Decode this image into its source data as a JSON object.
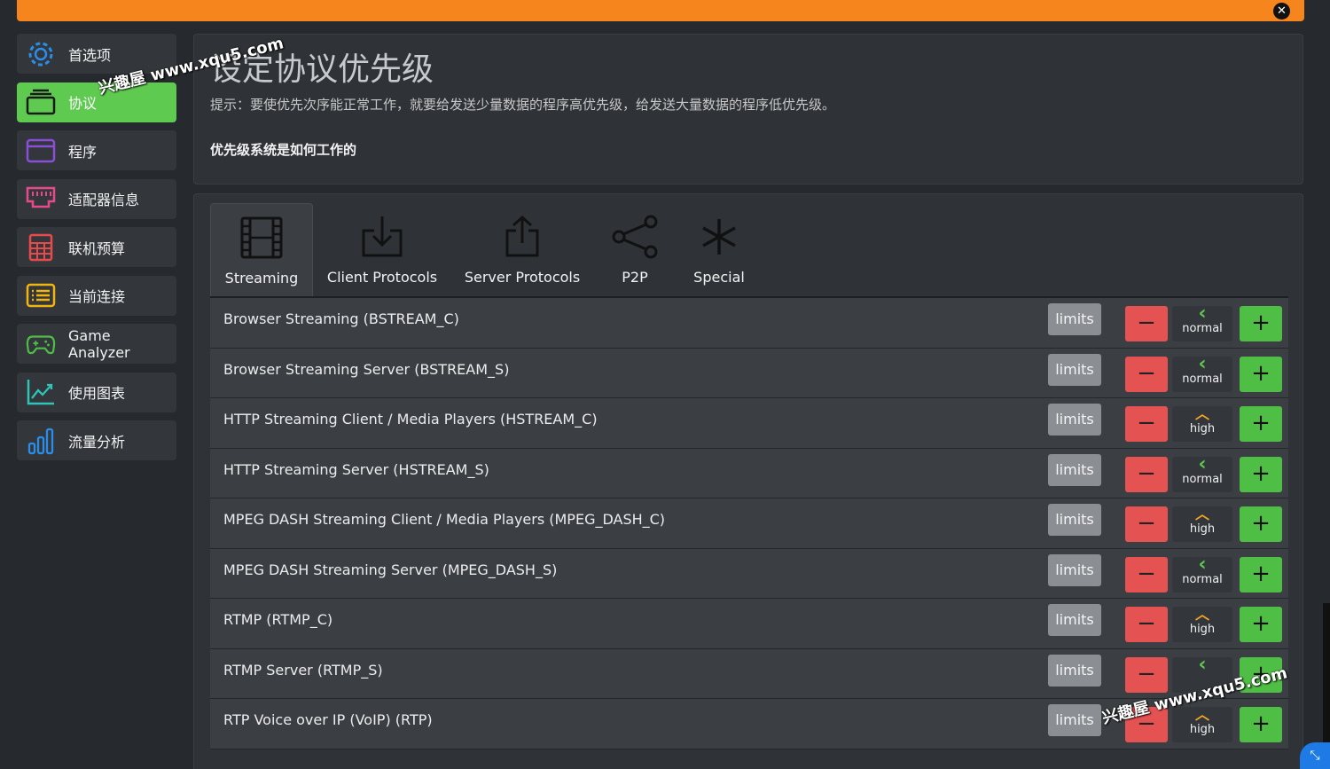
{
  "sidebar": {
    "items": [
      {
        "label": "首选项",
        "icon": "gear-icon",
        "active": false
      },
      {
        "label": "协议",
        "icon": "stack-icon",
        "active": true
      },
      {
        "label": "程序",
        "icon": "window-icon",
        "active": false
      },
      {
        "label": "适配器信息",
        "icon": "network-adapter-icon",
        "active": false
      },
      {
        "label": "联机预算",
        "icon": "calculator-icon",
        "active": false
      },
      {
        "label": "当前连接",
        "icon": "list-icon",
        "active": false
      },
      {
        "label": "Game Analyzer",
        "icon": "gamepad-icon",
        "active": false
      },
      {
        "label": "使用图表",
        "icon": "line-chart-icon",
        "active": false
      },
      {
        "label": "流量分析",
        "icon": "bar-chart-icon",
        "active": false
      }
    ]
  },
  "header": {
    "title": "设定协议优先级",
    "hint": "提示：要使优先次序能正常工作，就要给发送少量数据的程序高优先级，给发送大量数据的程序低优先级。",
    "how_link": "优先级系统是如何工作的"
  },
  "tabs": [
    {
      "label": "Streaming",
      "icon": "film-icon",
      "active": true
    },
    {
      "label": "Client Protocols",
      "icon": "download-icon",
      "active": false
    },
    {
      "label": "Server Protocols",
      "icon": "share-upload-icon",
      "active": false
    },
    {
      "label": "P2P",
      "icon": "share-nodes-icon",
      "active": false
    },
    {
      "label": "Special",
      "icon": "asterisk-icon",
      "active": false
    }
  ],
  "protocols": [
    {
      "name": "Browser Streaming (BSTREAM_C)",
      "limits": "limits",
      "priority": "normal"
    },
    {
      "name": "Browser Streaming Server (BSTREAM_S)",
      "limits": "limits",
      "priority": "normal"
    },
    {
      "name": "HTTP Streaming Client / Media Players (HSTREAM_C)",
      "limits": "limits",
      "priority": "high"
    },
    {
      "name": "HTTP Streaming Server (HSTREAM_S)",
      "limits": "limits",
      "priority": "normal"
    },
    {
      "name": "MPEG DASH Streaming Client / Media Players (MPEG_DASH_C)",
      "limits": "limits",
      "priority": "high"
    },
    {
      "name": "MPEG DASH Streaming Server (MPEG_DASH_S)",
      "limits": "limits",
      "priority": "normal"
    },
    {
      "name": "RTMP (RTMP_C)",
      "limits": "limits",
      "priority": "high"
    },
    {
      "name": "RTMP Server (RTMP_S)",
      "limits": "limits",
      "priority": ""
    },
    {
      "name": "RTP Voice over IP (VoIP) (RTP)",
      "limits": "limits",
      "priority": "high"
    }
  ],
  "buttons": {
    "minus": "−",
    "plus": "+"
  },
  "colors": {
    "accent_orange": "#f7851d",
    "active_green": "#5fca50",
    "minus_red": "#e55252",
    "plus_green": "#4fbe45",
    "high_arrow": "#f5a623",
    "normal_arrow": "#5fca50"
  },
  "watermark": {
    "text_top": "兴趣屋 www.xqu5.com",
    "text_bottom": "兴趣屋 www.xqu5.com"
  }
}
